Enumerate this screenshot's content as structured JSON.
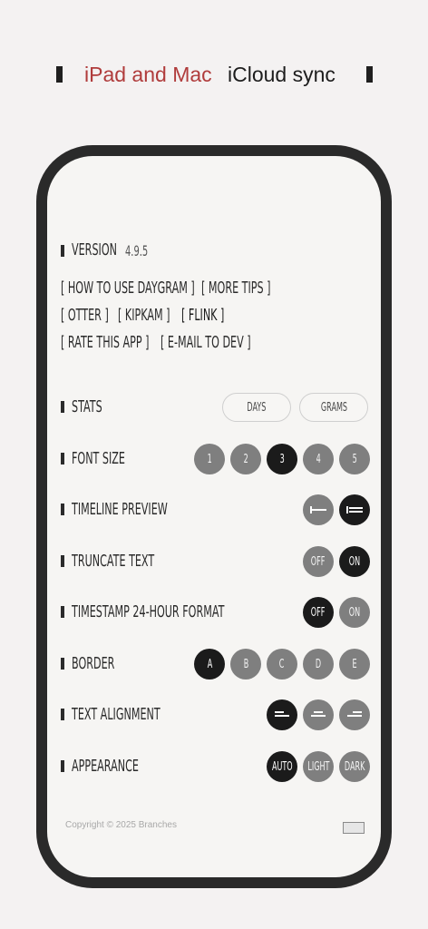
{
  "header": {
    "left_text": "iPad and Mac",
    "right_text": "iCloud sync",
    "accent_color": "#b03c3c"
  },
  "version": {
    "label": "Version",
    "value": "4.9.5"
  },
  "links": {
    "how_to_use": "[ How to use Daygram ]",
    "more_tips": "[ More tips ]",
    "otter": "[ Otter ]",
    "kipkam": "[ KipKam ]",
    "flink": "[ Flink ]",
    "rate_app": "[ Rate this app ]",
    "email_dev": "[ E-mail to dev ]"
  },
  "settings": {
    "stats": {
      "label": "Stats",
      "options": [
        "Days",
        "Grams"
      ]
    },
    "font_size": {
      "label": "Font size",
      "options": [
        "1",
        "2",
        "3",
        "4",
        "5"
      ],
      "selected": "3"
    },
    "timeline_preview": {
      "label": "Timeline preview",
      "options": [
        "timeline-single-line-icon",
        "timeline-multi-line-icon"
      ],
      "selected": "timeline-multi-line-icon"
    },
    "truncate_text": {
      "label": "Truncate text",
      "options": [
        "Off",
        "On"
      ],
      "selected": "On"
    },
    "timestamp_24h": {
      "label": "Timestamp 24-hour format",
      "options": [
        "Off",
        "On"
      ],
      "selected": "Off"
    },
    "border": {
      "label": "Border",
      "options": [
        "A",
        "B",
        "C",
        "D",
        "E"
      ],
      "selected": "A"
    },
    "text_alignment": {
      "label": "Text alignment",
      "options": [
        "align-left-icon",
        "align-center-icon",
        "align-right-icon"
      ],
      "selected": "align-left-icon"
    },
    "appearance": {
      "label": "Appearance",
      "options": [
        "Auto",
        "Light",
        "Dark"
      ],
      "selected": "Auto"
    }
  },
  "footer": {
    "copyright": "Copyright © 2025 Branches"
  }
}
